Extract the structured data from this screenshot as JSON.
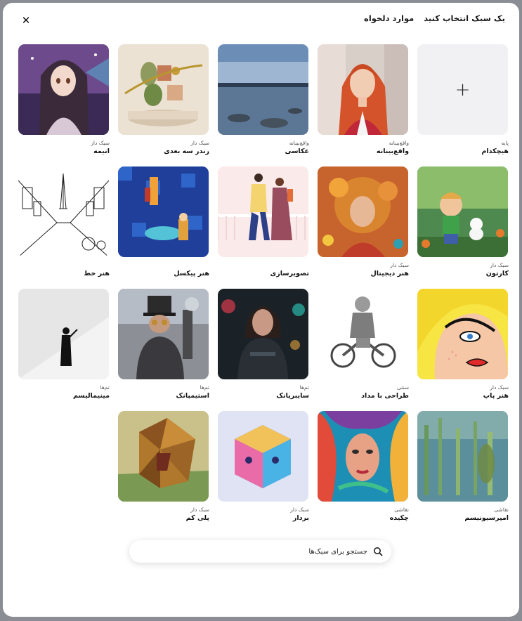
{
  "header": {
    "tab_choose_style": "یک سبک انتخاب کنید",
    "tab_favorites": "موارد دلخواه",
    "close_icon": "close-icon"
  },
  "styles": [
    {
      "id": "none",
      "label": "هیچکدام",
      "category": "پایه",
      "art": "none"
    },
    {
      "id": "realistic",
      "label": "واقع‌بینانه",
      "category": "واقع‌بینانه",
      "art": "redhair"
    },
    {
      "id": "photography",
      "label": "عکاسی",
      "category": "واقع‌بینانه",
      "art": "lake"
    },
    {
      "id": "render3d",
      "label": "رندر سه بعدی",
      "category": "سبک دار",
      "art": "render"
    },
    {
      "id": "anime",
      "label": "انیمه",
      "category": "سبک دار",
      "art": "anime"
    },
    {
      "id": "cartoon",
      "label": "کارتون",
      "category": "سبک دار",
      "art": "cartoon"
    },
    {
      "id": "digital",
      "label": "هنر دیجیتال",
      "category": "سبک دار",
      "art": "digital"
    },
    {
      "id": "illustration",
      "label": "تصویرسازی",
      "category": "",
      "art": "illus"
    },
    {
      "id": "pixel",
      "label": "هنر پیکسل",
      "category": "",
      "art": "pixel"
    },
    {
      "id": "lineart",
      "label": "هنر خط",
      "category": "",
      "art": "line"
    },
    {
      "id": "popart",
      "label": "هنر پاپ",
      "category": "سبک دار",
      "art": "pop"
    },
    {
      "id": "pencil",
      "label": "طراحی با مداد",
      "category": "سنتی",
      "art": "pencil"
    },
    {
      "id": "cyberpunk",
      "label": "سایبرپانک",
      "category": "تم‌ها",
      "art": "cyber"
    },
    {
      "id": "steampunk",
      "label": "استیمپانک",
      "category": "تم‌ها",
      "art": "steam"
    },
    {
      "id": "minimalism",
      "label": "مینیمالیسم",
      "category": "تم‌ها",
      "art": "minimal"
    },
    {
      "id": "impressionism",
      "label": "امپرسیونیسم",
      "category": "نقاشی",
      "art": "impress"
    },
    {
      "id": "drip",
      "label": "چکیده",
      "category": "نقاشی",
      "art": "drip"
    },
    {
      "id": "vector",
      "label": "بردار",
      "category": "سبک دار",
      "art": "vector"
    },
    {
      "id": "lowpoly",
      "label": "پلی کم",
      "category": "سبک دار",
      "art": "lowpoly"
    }
  ],
  "search": {
    "placeholder": "جستجو برای سبک‌ها",
    "icon": "search-icon"
  }
}
